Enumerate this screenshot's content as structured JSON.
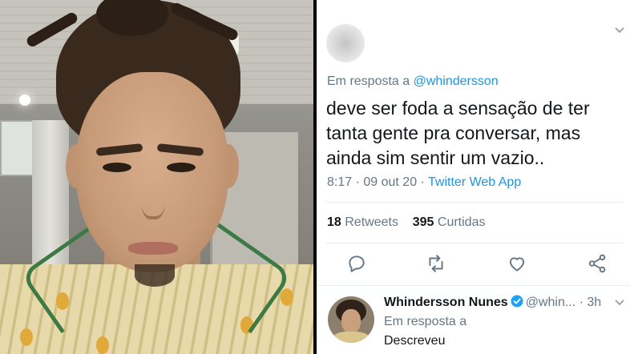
{
  "tweet": {
    "reply_prefix": "Em resposta a",
    "reply_handle": "@whindersson",
    "text": "deve ser foda a sensação de ter tanta gente pra conversar, mas ainda sim sentir um vazio..",
    "timestamp": "8:17 · 09 out 20 · ",
    "source": "Twitter Web App",
    "retweets_count": "18",
    "retweets_label": "Retweets",
    "likes_count": "395",
    "likes_label": "Curtidas"
  },
  "actions": {
    "icons": [
      "reply-icon",
      "retweet-icon",
      "like-icon",
      "share-icon"
    ],
    "color": "#657786"
  },
  "reply": {
    "name": "Whindersson Nunes",
    "handle": "@whin...",
    "dot": "·",
    "time": "3h",
    "reply_prefix": "Em resposta a",
    "text": "Descreveu"
  },
  "colors": {
    "link": "#1b95e0",
    "muted": "#657786",
    "text": "#14171a",
    "separator": "#e6ecf0",
    "divider": "#000000"
  }
}
